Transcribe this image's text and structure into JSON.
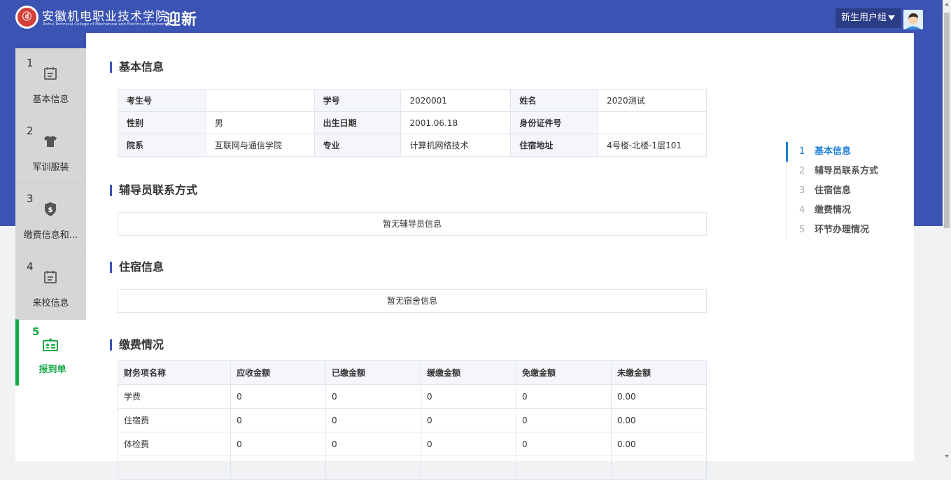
{
  "header": {
    "logo_text": "ⓓ",
    "school_name_cn": "安徽机电职业技术学院",
    "school_name_en": "Anhui Technical College of Mechanical and Electrical Engineering",
    "app_title": "迎新",
    "user_group": "新生用户组"
  },
  "steps": [
    {
      "num": "1",
      "label": "基本信息",
      "icon": "calendar-icon"
    },
    {
      "num": "2",
      "label": "军训服装",
      "icon": "tshirt-icon"
    },
    {
      "num": "3",
      "label": "缴费信息和...",
      "icon": "shield-dollar-icon"
    },
    {
      "num": "4",
      "label": "来校信息",
      "icon": "calendar-icon"
    },
    {
      "num": "5",
      "label": "报到单",
      "icon": "id-card-icon",
      "active": true
    }
  ],
  "basic_info": {
    "title": "基本信息",
    "rows": [
      [
        {
          "k": "考生号",
          "v": ""
        },
        {
          "k": "学号",
          "v": "2020001"
        },
        {
          "k": "姓名",
          "v": "2020测试"
        }
      ],
      [
        {
          "k": "性别",
          "v": "男"
        },
        {
          "k": "出生日期",
          "v": "2001.06.18"
        },
        {
          "k": "身份证件号",
          "v": ""
        }
      ],
      [
        {
          "k": "院系",
          "v": "互联网与通信学院"
        },
        {
          "k": "专业",
          "v": "计算机网络技术"
        },
        {
          "k": "住宿地址",
          "v": "4号楼-北楼-1层101"
        }
      ]
    ]
  },
  "counselor": {
    "title": "辅导员联系方式",
    "empty": "暂无辅导员信息"
  },
  "dorm": {
    "title": "住宿信息",
    "empty": "暂无宿舍信息"
  },
  "fees": {
    "title": "缴费情况",
    "headers": [
      "财务项名称",
      "应收金额",
      "已缴金额",
      "缓缴金额",
      "免缴金额",
      "未缴金额"
    ],
    "rows": [
      [
        "学费",
        "0",
        "0",
        "0",
        "0",
        "0.00"
      ],
      [
        "住宿费",
        "0",
        "0",
        "0",
        "0",
        "0.00"
      ],
      [
        "体检费",
        "0",
        "0",
        "0",
        "0",
        "0.00"
      ]
    ]
  },
  "toc": [
    {
      "num": "1",
      "label": "基本信息",
      "active": true
    },
    {
      "num": "2",
      "label": "辅导员联系方式"
    },
    {
      "num": "3",
      "label": "住宿信息"
    },
    {
      "num": "4",
      "label": "缴费情况"
    },
    {
      "num": "5",
      "label": "环节办理情况"
    }
  ],
  "colors": {
    "brand": "#3b53b3",
    "active_green": "#14a845",
    "toc_active": "#1e7fd6"
  }
}
